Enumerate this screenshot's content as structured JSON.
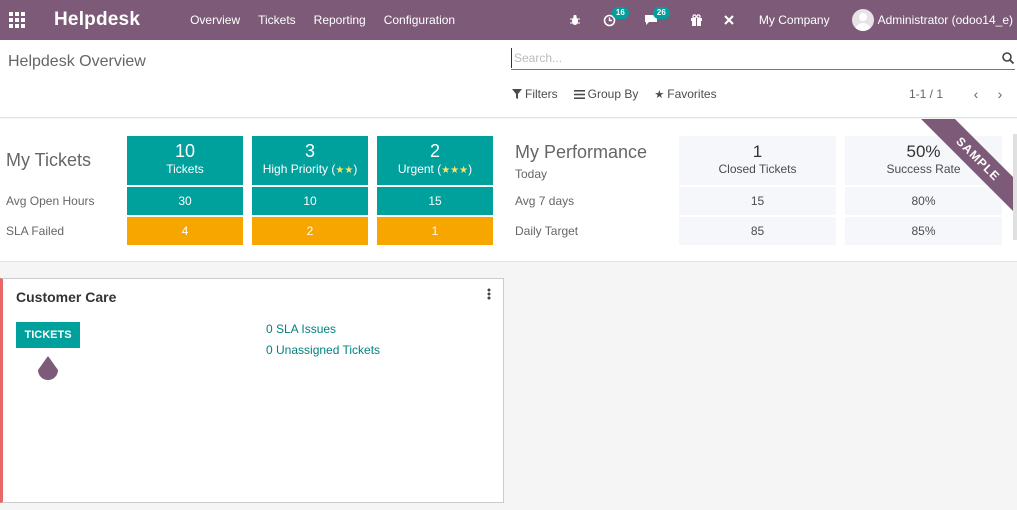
{
  "navbar": {
    "brand": "Helpdesk",
    "menu": [
      "Overview",
      "Tickets",
      "Reporting",
      "Configuration"
    ],
    "activity_count": "16",
    "messages_count": "26",
    "company": "My Company",
    "user": "Administrator (odoo14_e)",
    "color": "#7c5a78"
  },
  "control": {
    "title": "Helpdesk Overview",
    "search_placeholder": "Search...",
    "filters_label": "Filters",
    "group_by_label": "Group By",
    "favorites_label": "Favorites",
    "pager_value": "1-1 / 1"
  },
  "my_tickets": {
    "title": "My Tickets",
    "row_labels": [
      "Avg Open Hours",
      "SLA Failed"
    ],
    "columns": [
      {
        "count": "10",
        "label": "Tickets",
        "stars": "",
        "avg_hours": "30",
        "sla_failed": "4"
      },
      {
        "count": "3",
        "label": "High Priority (",
        "stars": "★★",
        "suffix": ")",
        "avg_hours": "10",
        "sla_failed": "2"
      },
      {
        "count": "2",
        "label": "Urgent (",
        "stars": "★★★",
        "suffix": ")",
        "avg_hours": "15",
        "sla_failed": "1"
      }
    ]
  },
  "performance": {
    "title": "My Performance",
    "row_labels": [
      "Today",
      "Avg 7 days",
      "Daily Target"
    ],
    "columns": [
      {
        "value": "1",
        "label": "Closed Tickets",
        "avg7": "15",
        "target": "85"
      },
      {
        "value": "50%",
        "label": "Success Rate",
        "avg7": "80%",
        "target": "85%"
      }
    ],
    "ribbon": "SAMPLE"
  },
  "team": {
    "name": "Customer Care",
    "button": "TICKETS",
    "sla_issues": "0 SLA Issues",
    "unassigned": "0 Unassigned Tickets",
    "accent": "#e86868"
  },
  "colors": {
    "teal": "#00a09d",
    "orange": "#f7a600"
  }
}
